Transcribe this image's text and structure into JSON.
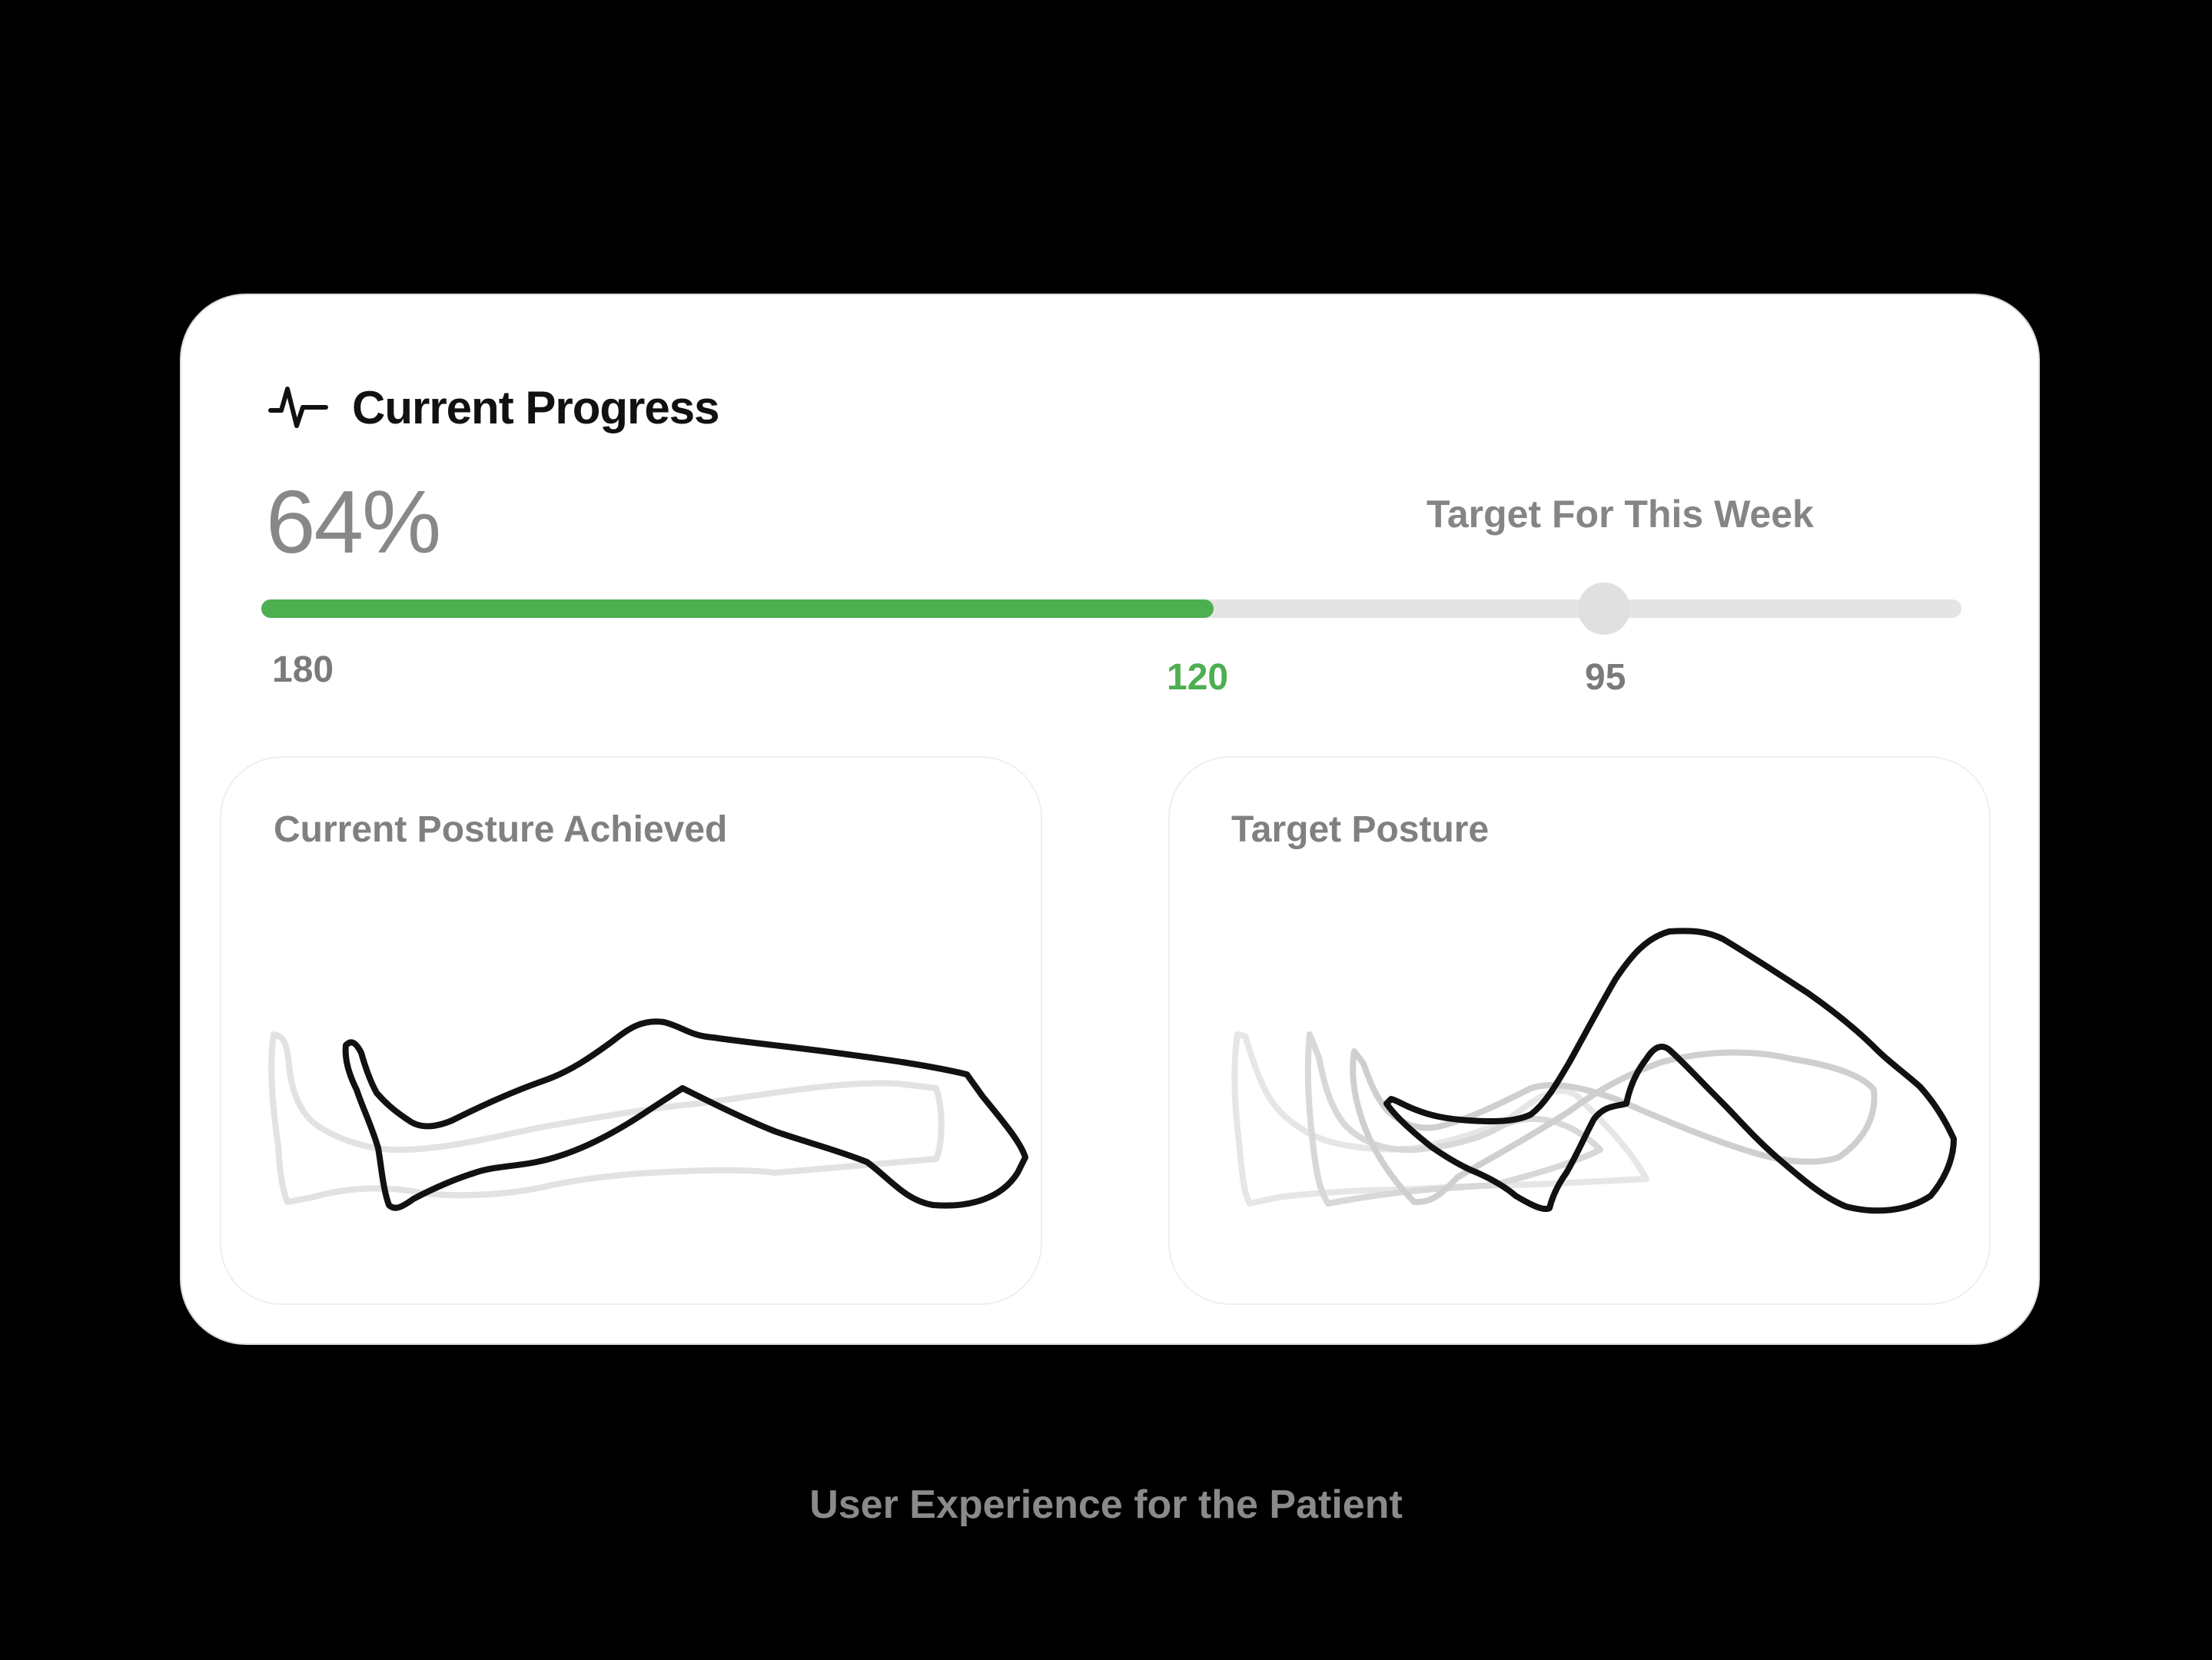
{
  "progress": {
    "title": "Current Progress",
    "percent_label": "64%",
    "target_label": "Target For This Week",
    "start_value": "180",
    "current_value": "120",
    "target_value": "95",
    "fill_fraction": 0.56,
    "target_fraction": 0.79
  },
  "panels": {
    "current": {
      "title": "Current Posture Achieved"
    },
    "target": {
      "title": "Target Posture"
    }
  },
  "caption": "User Experience for the Patient",
  "colors": {
    "accent": "#4caf50",
    "track": "#e4e4e4",
    "knob": "#e0e0e0",
    "background": "#000000",
    "card": "#ffffff"
  },
  "icons": {
    "header": "pulse-icon"
  }
}
